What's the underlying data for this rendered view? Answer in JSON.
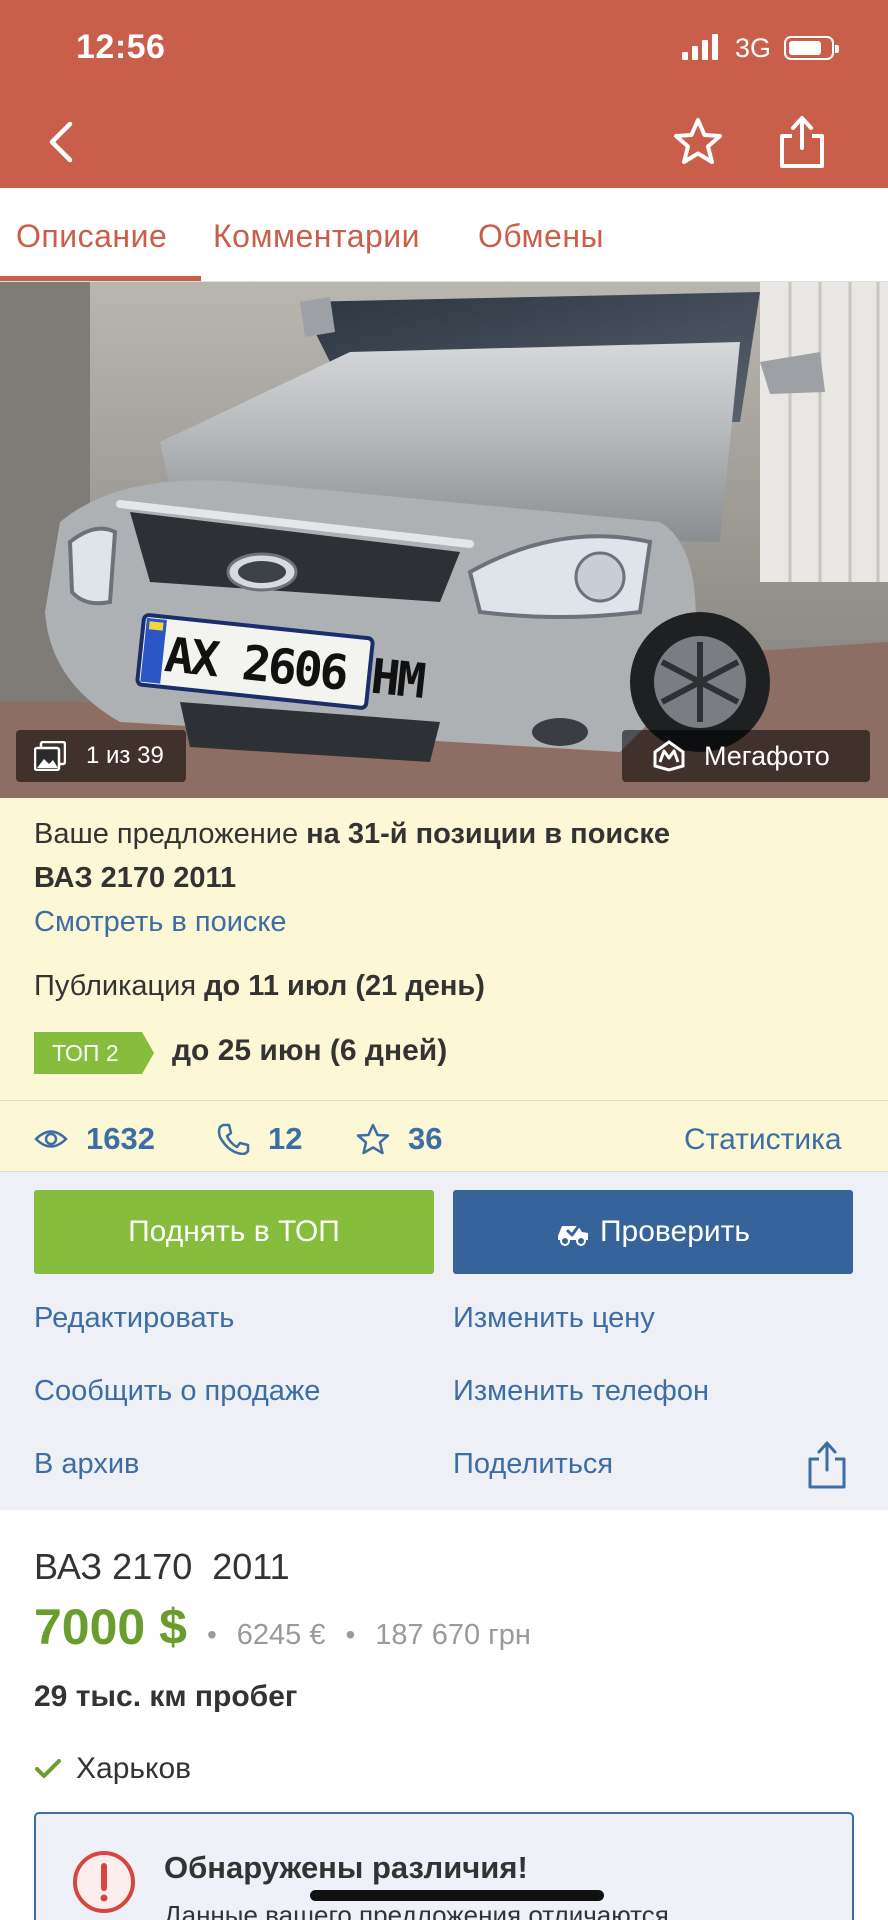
{
  "status_bar": {
    "time": "12:56",
    "network": "3G"
  },
  "tabs": [
    {
      "label": "Описание",
      "active": true
    },
    {
      "label": "Комментарии",
      "active": false
    },
    {
      "label": "Обмены",
      "active": false
    }
  ],
  "photo": {
    "counter": "1 из 39",
    "badge": "Мегафото",
    "plate_text": "AX 2606 HM"
  },
  "promo": {
    "position_prefix": "Ваше предложение ",
    "position_bold": "на 31-й позиции в поиске",
    "model": "ВАЗ 2170 2011",
    "search_link": "Смотреть в поиске",
    "publication_prefix": "Публикация ",
    "publication_bold": "до 11 июл (21 день)",
    "top_badge": "ТОП 2",
    "top_until": "до 25 июн (6 дней)"
  },
  "stats": {
    "views": "1632",
    "calls": "12",
    "favorites": "36",
    "statistics_link": "Статистика"
  },
  "actions": {
    "raise_top": "Поднять в ТОП",
    "check": "Проверить",
    "edit": "Редактировать",
    "change_price": "Изменить цену",
    "report_sale": "Сообщить о продаже",
    "change_phone": "Изменить телефон",
    "archive": "В архив",
    "share": "Поделиться"
  },
  "listing": {
    "title": "ВАЗ 2170  2011",
    "price_usd": "7000 $",
    "price_eur": "6245 €",
    "price_uah": "187 670 грн",
    "mileage": "29 тыс. км пробег",
    "city": "Харьков"
  },
  "alert": {
    "title": "Обнаружены различия!",
    "text": "Данные вашего предложения отличаются"
  },
  "colors": {
    "header": "#c95f4b",
    "link": "#3c6ea5",
    "green": "#86bd3c",
    "price_green": "#6a9d2d",
    "blue_button": "#36649a",
    "promo_bg": "#fcf8d5"
  }
}
